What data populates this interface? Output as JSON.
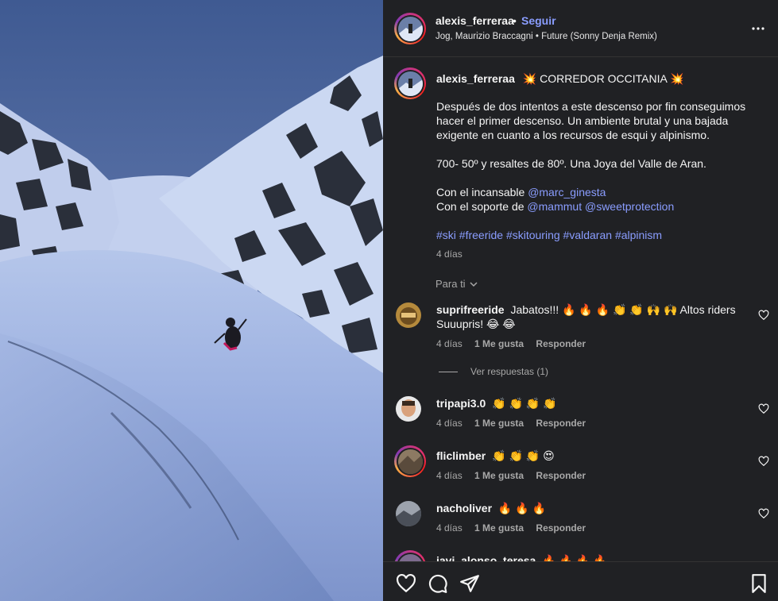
{
  "post": {
    "username": "alexis_ferreraa",
    "follow_label": "Seguir",
    "separator": "•",
    "audio": "Jog, Maurizio Braccagni • Future (Sonny Denja Remix)"
  },
  "caption": {
    "username": "alexis_ferreraa",
    "title": "CORREDOR OCCITANIA",
    "spark": "💥",
    "paragraph1": "Después de dos intentos a este descenso por fin conseguimos hacer el primer descenso. Un ambiente brutal y una bajada exigente en cuanto a los recursos de esqui y alpinismo.",
    "paragraph2": "700- 50º y resaltes de 80º. Una Joya del Valle de Aran.",
    "with_prefix": "Con el incansable",
    "with_mention": "@marc_ginesta",
    "support_prefix": "Con el soporte de",
    "support_mention1": "@mammut",
    "support_mention2": "@sweetprotection",
    "hashtags": [
      "#ski",
      "#freeride",
      "#skitouring",
      "#valdaran",
      "#alpinism"
    ],
    "time": "4 días"
  },
  "filter_label": "Para ti",
  "view_replies": "Ver respuestas (1)",
  "comments": [
    {
      "username": "suprifreeride",
      "text": "Jabatos!!! 🔥 🔥 🔥 👏 👏 🙌 🙌  Altos riders Suuupris! 😂 😂",
      "time": "4 días",
      "likes": "1 Me gusta",
      "reply": "Responder"
    },
    {
      "username": "tripapi3.0",
      "text": "👏 👏 👏 👏",
      "time": "4 días",
      "likes": "1 Me gusta",
      "reply": "Responder"
    },
    {
      "username": "fliclimber",
      "text": "👏 👏 👏 😍",
      "time": "4 días",
      "likes": "1 Me gusta",
      "reply": "Responder"
    },
    {
      "username": "nacholiver",
      "text": "🔥 🔥 🔥",
      "time": "4 días",
      "likes": "1 Me gusta",
      "reply": "Responder"
    },
    {
      "username": "javi_alonso_teresa",
      "text": "🔥 🔥 🔥 🔥",
      "time": "",
      "likes": "",
      "reply": ""
    }
  ],
  "icons": {
    "more": "more-options-icon",
    "like": "heart-icon",
    "comment": "comment-icon",
    "share": "share-icon",
    "save": "bookmark-icon",
    "chevron": "chevron-down-icon"
  },
  "colors": {
    "panel_bg": "#202124",
    "link": "#8a9dff",
    "muted": "#a8a8a8"
  }
}
